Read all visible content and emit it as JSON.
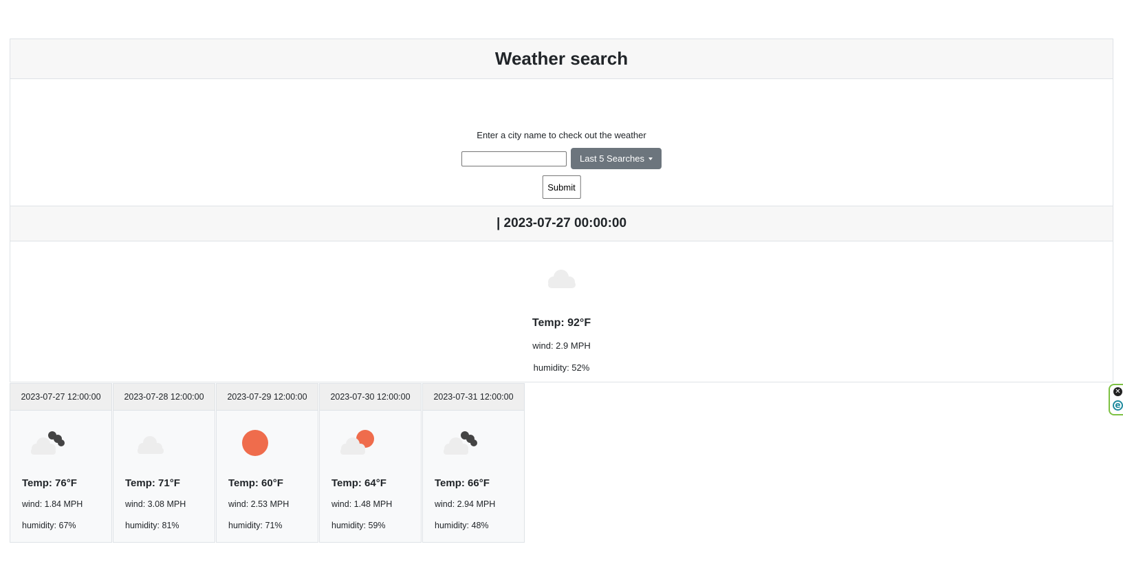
{
  "header": {
    "title": "Weather search"
  },
  "search": {
    "prompt": "Enter a city name to check out the weather",
    "input_value": "",
    "input_placeholder": "",
    "dropdown_label": "Last 5 Searches",
    "submit_label": "Submit"
  },
  "current": {
    "heading": "| 2023-07-27 00:00:00",
    "icon": "cloud-icon",
    "temp": "Temp: 92°F",
    "wind": "wind: 2.9 MPH",
    "humidity": "humidity: 52%"
  },
  "forecast": [
    {
      "date": "2023-07-27 12:00:00",
      "icon": "cloud-night-icon",
      "temp": "Temp: 76°F",
      "wind": "wind: 1.84 MPH",
      "humidity": "humidity: 67%"
    },
    {
      "date": "2023-07-28 12:00:00",
      "icon": "cloud-icon",
      "temp": "Temp: 71°F",
      "wind": "wind: 3.08 MPH",
      "humidity": "humidity: 81%"
    },
    {
      "date": "2023-07-29 12:00:00",
      "icon": "sun-icon",
      "temp": "Temp: 60°F",
      "wind": "wind: 2.53 MPH",
      "humidity": "humidity: 71%"
    },
    {
      "date": "2023-07-30 12:00:00",
      "icon": "partly-cloudy-icon",
      "temp": "Temp: 64°F",
      "wind": "wind: 1.48 MPH",
      "humidity": "humidity: 59%"
    },
    {
      "date": "2023-07-31 12:00:00",
      "icon": "cloud-night-icon",
      "temp": "Temp: 66°F",
      "wind": "wind: 2.94 MPH",
      "humidity": "humidity: 48%"
    }
  ],
  "extension": {
    "close_glyph": "✕",
    "logo_glyph": "e"
  },
  "colors": {
    "sun": "#ef6c4c",
    "cloud": "#ededed",
    "dark_cloud": "#444444",
    "button_secondary": "#6c757d"
  }
}
